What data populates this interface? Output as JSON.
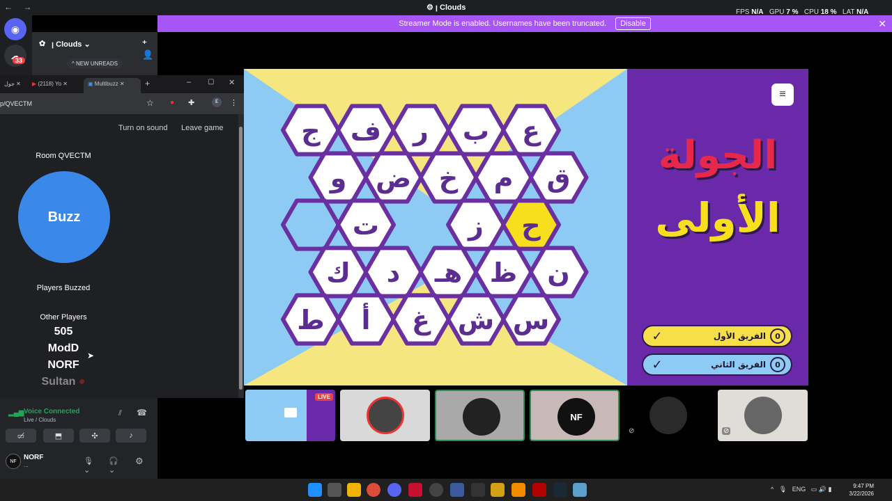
{
  "titlebar": {
    "title": "Clouds",
    "fps_label": "FPS",
    "fps": "N/A",
    "gpu_label": "GPU",
    "gpu": "7 %",
    "cpu_label": "CPU",
    "cpu": "18 %",
    "lat_label": "LAT",
    "lat": "N/A"
  },
  "banner": {
    "text": "Streamer Mode is enabled. Usernames have been truncated.",
    "button": "Disable"
  },
  "server": {
    "name": "Clouds",
    "new_unreads": "NEW UNREADS"
  },
  "guild_badges": {
    "mention_count": "33"
  },
  "voice": {
    "status": "Voice Connected",
    "channel": "Live / Clouds"
  },
  "user": {
    "name": "NORF",
    "status": "..."
  },
  "browser": {
    "tabs": [
      {
        "label": "جول"
      },
      {
        "label": "(2118) Yo"
      },
      {
        "label": "Multibuzz"
      }
    ],
    "url": "p/QVECTM",
    "sound_link": "Turn on sound",
    "leave_link": "Leave game",
    "room": "Room QVECTM",
    "buzz": "Buzz",
    "players_buzzed": "Players Buzzed",
    "other_players_label": "Other Players",
    "players": [
      "505",
      "ModD",
      "NORF",
      "Sultan"
    ]
  },
  "game": {
    "hex_rows": [
      [
        "ج",
        "ف",
        "ر",
        "ب",
        "ع"
      ],
      [
        "و",
        "ض",
        "خ",
        "م",
        "ق"
      ],
      [
        "",
        "ت",
        "",
        "ز",
        "ح"
      ],
      [
        "ك",
        "د",
        "هـ",
        "ظ",
        "ن"
      ],
      [
        "ط",
        "أ",
        "غ",
        "ش",
        "س"
      ]
    ],
    "title_line1": "الجولة",
    "title_line2": "الأولى",
    "team1": {
      "name": "الفريق الأول",
      "score": "0"
    },
    "team2": {
      "name": "الفريق الثاني",
      "score": "0"
    }
  },
  "tiles": {
    "live_badge": "LIVE",
    "nf_label": "NF"
  },
  "taskbar": {
    "lang": "ENG",
    "time": "9:47 PM",
    "date": "3/22/2026"
  },
  "colors": {
    "hex_fill": "#ffffff",
    "hex_border": "#6a2fa0",
    "hex_highlight": "#f7df1e",
    "hex_letter": "#5b2d90",
    "sky": "#8ecbf4",
    "yellow": "#f6e680",
    "title_red": "#e6284a",
    "title_yellow": "#f7df1e",
    "team1": "#f7df4a",
    "team2": "#8ecbf4"
  }
}
